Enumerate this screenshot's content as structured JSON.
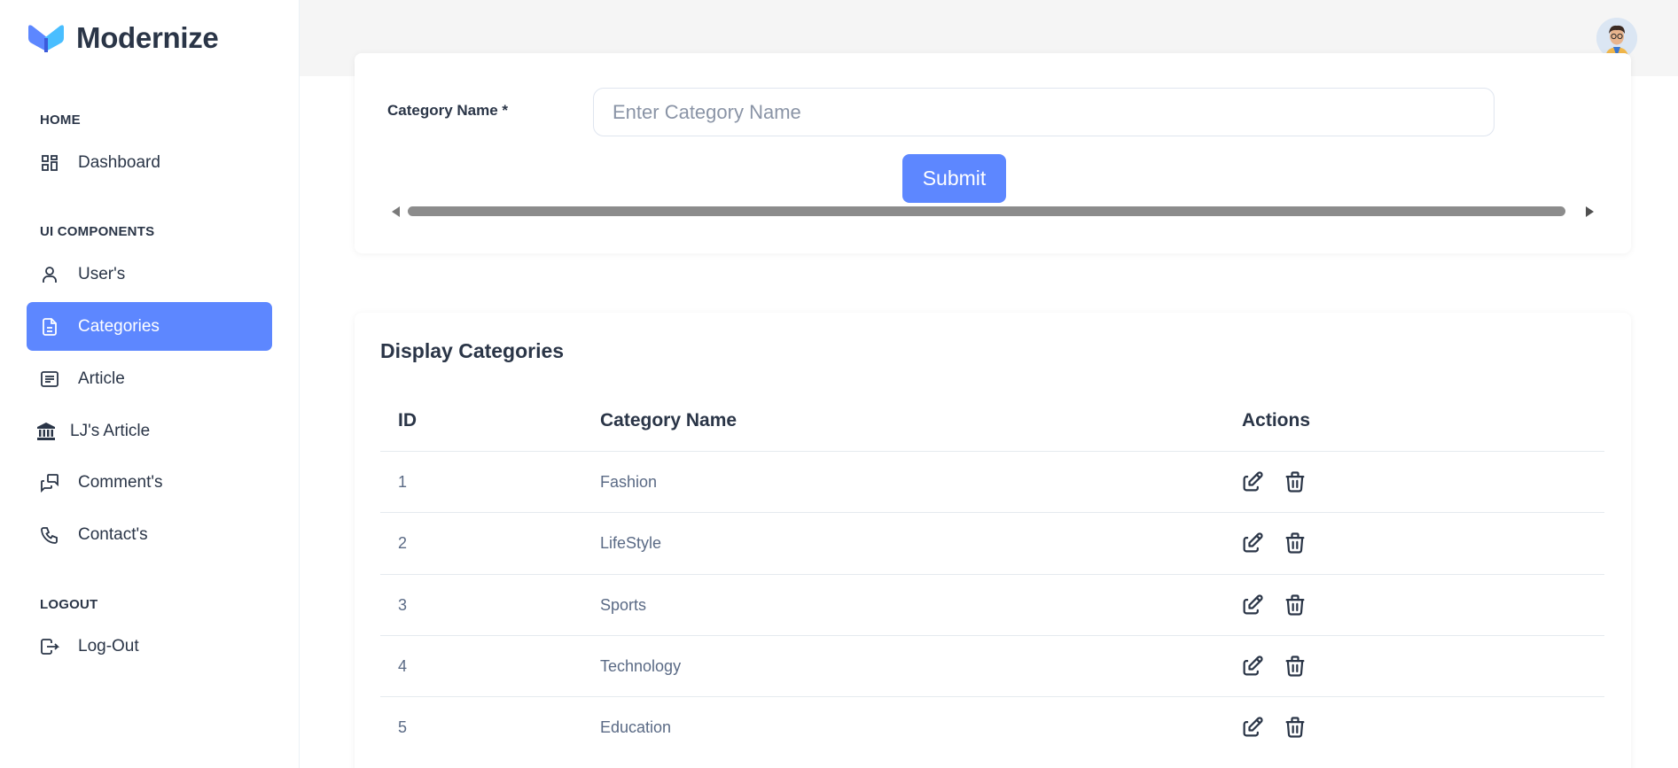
{
  "brand": {
    "name": "Modernize",
    "logo_icon": "modernize-logo-icon"
  },
  "sidebar": {
    "sections": [
      {
        "label": "HOME"
      },
      {
        "label": "UI COMPONENTS"
      },
      {
        "label": "LOGOUT"
      }
    ],
    "items": [
      {
        "label": "Dashboard",
        "icon": "dashboard-icon"
      },
      {
        "label": "User's",
        "icon": "user-icon"
      },
      {
        "label": "Categories",
        "icon": "file-text-icon",
        "active": true
      },
      {
        "label": "Article",
        "icon": "article-icon"
      },
      {
        "label": "LJ's Article",
        "icon": "bank-icon"
      },
      {
        "label": "Comment's",
        "icon": "messages-icon"
      },
      {
        "label": "Contact's",
        "icon": "phone-icon"
      },
      {
        "label": "Log-Out",
        "icon": "logout-icon"
      }
    ]
  },
  "form": {
    "label": "Category Name *",
    "placeholder": "Enter Category Name",
    "value": "",
    "submit_label": "Submit"
  },
  "table": {
    "title": "Display Categories",
    "columns": [
      "ID",
      "Category Name",
      "Actions"
    ],
    "rows": [
      {
        "id": "1",
        "name": "Fashion"
      },
      {
        "id": "2",
        "name": "LifeStyle"
      },
      {
        "id": "3",
        "name": "Sports"
      },
      {
        "id": "4",
        "name": "Technology"
      },
      {
        "id": "5",
        "name": "Education"
      }
    ]
  },
  "colors": {
    "accent": "#5d87ff",
    "text": "#2a3547",
    "muted": "#5a6a85",
    "header_bg": "#f5f5f5"
  }
}
